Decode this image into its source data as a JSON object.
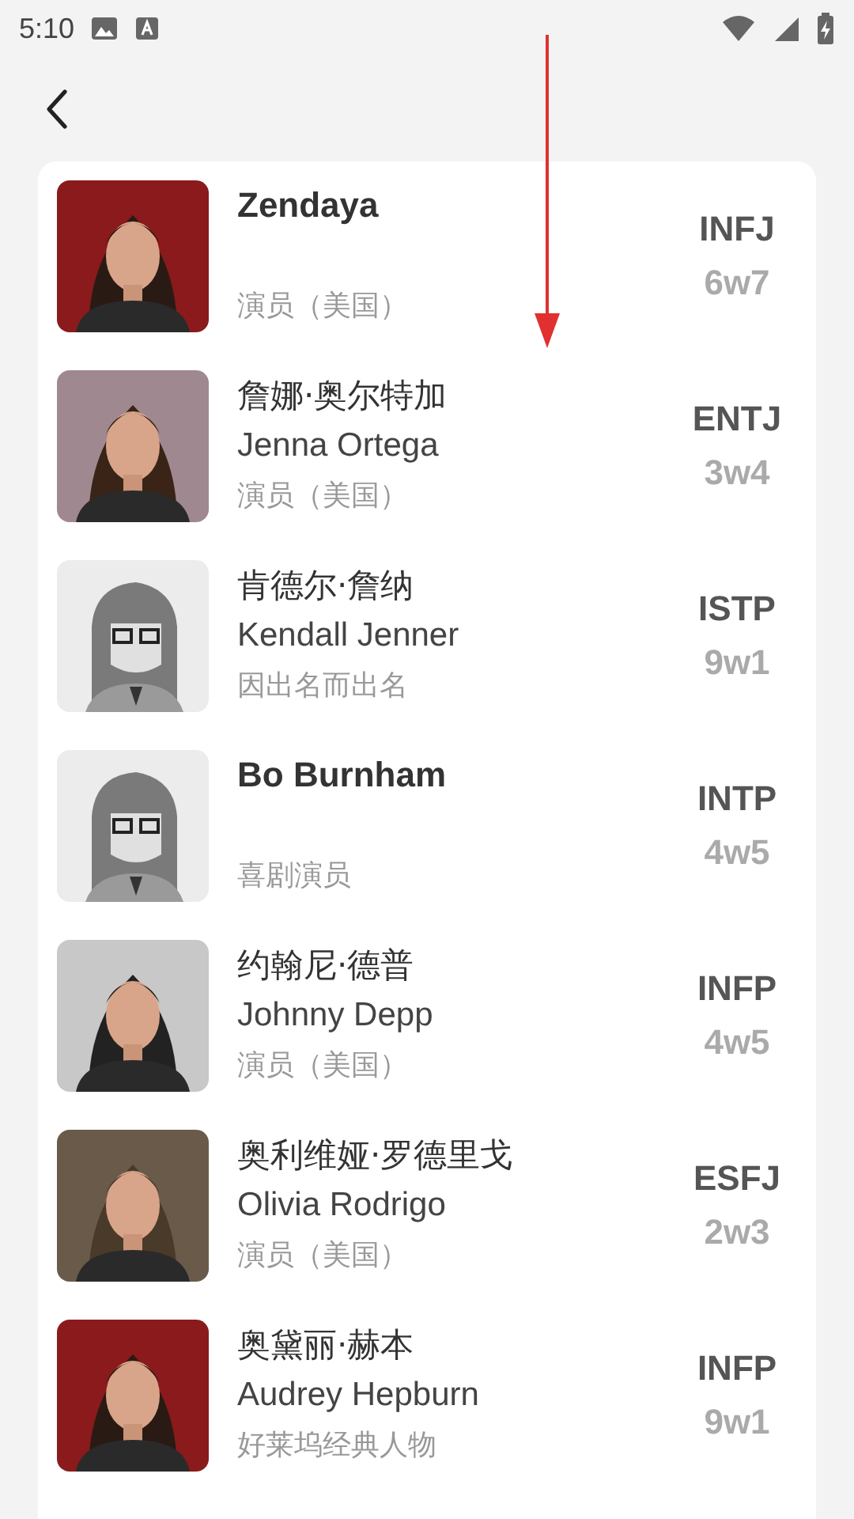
{
  "status_bar": {
    "time": "5:10"
  },
  "people": [
    {
      "name": "Zendaya",
      "bold": true,
      "role": "演员（美国）",
      "mbti": "INFJ",
      "enneagram": "6w7",
      "kind": "picture"
    },
    {
      "name": "詹娜·奥尔特加",
      "bold": false,
      "english_name": "Jenna Ortega",
      "role": "演员（美国）",
      "mbti": "ENTJ",
      "enneagram": "3w4",
      "kind": "picture"
    },
    {
      "name": "肯德尔·詹纳",
      "bold": false,
      "english_name": "Kendall Jenner",
      "role": "因出名而出名",
      "mbti": "ISTP",
      "enneagram": "9w1",
      "kind": "placeholder"
    },
    {
      "name": "Bo Burnham",
      "bold": true,
      "role": "喜剧演员",
      "mbti": "INTP",
      "enneagram": "4w5",
      "kind": "placeholder"
    },
    {
      "name": "约翰尼·德普",
      "bold": false,
      "english_name": "Johnny Depp",
      "role": "演员（美国）",
      "mbti": "INFP",
      "enneagram": "4w5",
      "kind": "picture"
    },
    {
      "name": "奥利维娅·罗德里戈",
      "bold": false,
      "english_name": "Olivia Rodrigo",
      "role": "演员（美国）",
      "mbti": "ESFJ",
      "enneagram": "2w3",
      "kind": "picture"
    },
    {
      "name": "奥黛丽·赫本",
      "bold": false,
      "english_name": "Audrey Hepburn",
      "role": "好莱坞经典人物",
      "mbti": "INFP",
      "enneagram": "9w1",
      "kind": "picture"
    }
  ]
}
